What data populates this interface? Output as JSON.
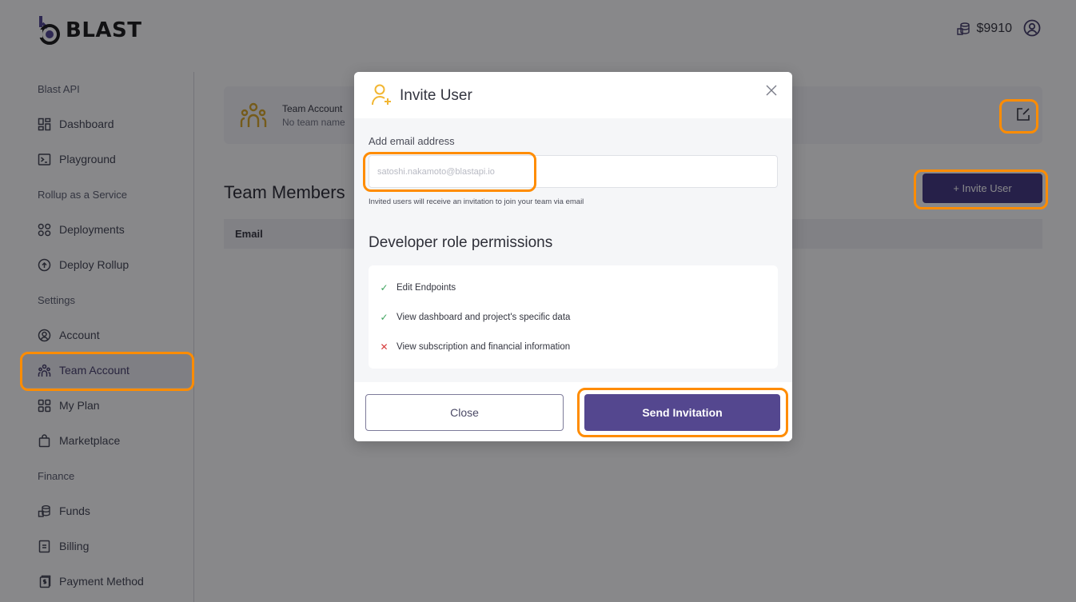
{
  "brand": {
    "name": "BLAST"
  },
  "header": {
    "balance": "$9910",
    "balance_icon": "coins-icon",
    "profile_icon": "user-circle-icon"
  },
  "sidebar": {
    "sections": [
      {
        "label": "Blast API",
        "items": [
          {
            "label": "Dashboard",
            "icon": "dashboard-icon"
          },
          {
            "label": "Playground",
            "icon": "terminal-icon"
          }
        ]
      },
      {
        "label": "Rollup as a Service",
        "items": [
          {
            "label": "Deployments",
            "icon": "grid-icon"
          },
          {
            "label": "Deploy Rollup",
            "icon": "upload-circle-icon"
          }
        ]
      },
      {
        "label": "Settings",
        "items": [
          {
            "label": "Account",
            "icon": "user-circle-icon"
          },
          {
            "label": "Team Account",
            "icon": "team-icon",
            "active": true
          },
          {
            "label": "My Plan",
            "icon": "grid-icon"
          },
          {
            "label": "Marketplace",
            "icon": "shopping-bag-icon"
          }
        ]
      },
      {
        "label": "Finance",
        "items": [
          {
            "label": "Funds",
            "icon": "coins-icon"
          },
          {
            "label": "Billing",
            "icon": "document-icon"
          },
          {
            "label": "Payment Method",
            "icon": "invoice-icon"
          }
        ]
      }
    ]
  },
  "main": {
    "team_card": {
      "title": "Team Account",
      "subtitle": "No team name"
    },
    "members_title": "Team Members",
    "invite_button": "+ Invite User",
    "table": {
      "columns": [
        "Email"
      ],
      "rows": []
    }
  },
  "modal": {
    "title": "Invite User",
    "email_label": "Add email address",
    "email_value": "",
    "email_placeholder": "satoshi.nakamoto@blastapi.io",
    "email_hint": "Invited users will receive an invitation to join your team via email",
    "permissions_title": "Developer role permissions",
    "permissions": [
      {
        "label": "Edit Endpoints",
        "allowed": true,
        "mark": "✓"
      },
      {
        "label": "View dashboard and project's specific data",
        "allowed": true,
        "mark": "✓"
      },
      {
        "label": "View subscription and financial information",
        "allowed": false,
        "mark": "✕"
      }
    ],
    "close_button": "Close",
    "send_button": "Send Invitation"
  },
  "colors": {
    "brand_purple": "#54478f",
    "invite_button": "#3a2f7d",
    "accent_gold": "#f2b632",
    "highlight_orange": "#ff8c00",
    "allowed_green": "#3da35d",
    "denied_red": "#d63a3a"
  }
}
